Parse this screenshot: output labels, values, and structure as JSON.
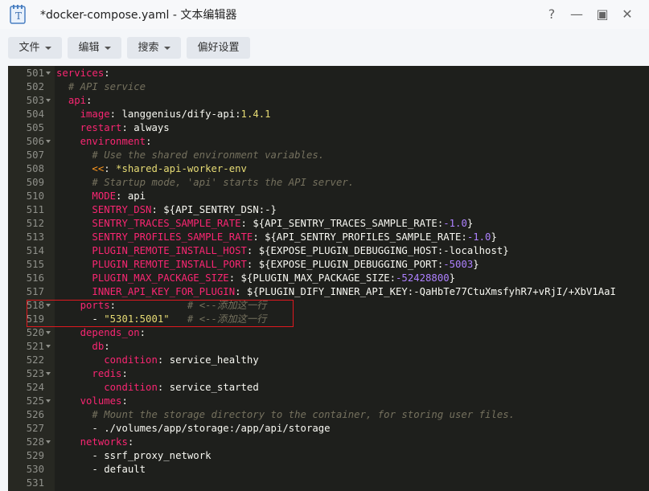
{
  "window": {
    "title": "*docker-compose.yaml - 文本编辑器",
    "controls": [
      "?",
      "—",
      "▣",
      "✕"
    ]
  },
  "toolbar": {
    "file": "文件",
    "edit": "编辑",
    "search": "搜索",
    "prefs": "偏好设置"
  },
  "lines": [
    {
      "no": "501",
      "fold": true,
      "parts": [
        [
          "k",
          "services"
        ],
        [
          "p",
          ":"
        ]
      ]
    },
    {
      "no": "502",
      "parts": [
        [
          "p",
          "  "
        ],
        [
          "c",
          "# API service"
        ]
      ]
    },
    {
      "no": "503",
      "fold": true,
      "parts": [
        [
          "p",
          "  "
        ],
        [
          "k",
          "api"
        ],
        [
          "p",
          ":"
        ]
      ]
    },
    {
      "no": "504",
      "parts": [
        [
          "p",
          "    "
        ],
        [
          "k",
          "image"
        ],
        [
          "p",
          ": "
        ],
        [
          "d",
          "langgenius/dify-api"
        ],
        [
          "p",
          ":"
        ],
        [
          "s",
          "1.4.1"
        ]
      ]
    },
    {
      "no": "505",
      "parts": [
        [
          "p",
          "    "
        ],
        [
          "k",
          "restart"
        ],
        [
          "p",
          ": "
        ],
        [
          "d",
          "always"
        ]
      ]
    },
    {
      "no": "506",
      "fold": true,
      "parts": [
        [
          "p",
          "    "
        ],
        [
          "k",
          "environment"
        ],
        [
          "p",
          ":"
        ]
      ]
    },
    {
      "no": "507",
      "parts": [
        [
          "p",
          "      "
        ],
        [
          "c",
          "# Use the shared environment variables."
        ]
      ]
    },
    {
      "no": "508",
      "parts": [
        [
          "p",
          "      "
        ],
        [
          "a",
          "<<"
        ],
        [
          "p",
          ": "
        ],
        [
          "s",
          "*shared-api-worker-env"
        ]
      ]
    },
    {
      "no": "509",
      "parts": [
        [
          "p",
          "      "
        ],
        [
          "c",
          "# Startup mode, 'api' starts the API server."
        ]
      ]
    },
    {
      "no": "510",
      "parts": [
        [
          "p",
          "      "
        ],
        [
          "k",
          "MODE"
        ],
        [
          "p",
          ": "
        ],
        [
          "d",
          "api"
        ]
      ]
    },
    {
      "no": "511",
      "parts": [
        [
          "p",
          "      "
        ],
        [
          "k",
          "SENTRY_DSN"
        ],
        [
          "p",
          ": "
        ],
        [
          "d",
          "${API_SENTRY_DSN:-}"
        ]
      ]
    },
    {
      "no": "512",
      "parts": [
        [
          "p",
          "      "
        ],
        [
          "k",
          "SENTRY_TRACES_SAMPLE_RATE"
        ],
        [
          "p",
          ": "
        ],
        [
          "d",
          "${API_SENTRY_TRACES_SAMPLE_RATE:"
        ],
        [
          "n",
          "-1.0"
        ],
        [
          "d",
          "}"
        ]
      ]
    },
    {
      "no": "513",
      "parts": [
        [
          "p",
          "      "
        ],
        [
          "k",
          "SENTRY_PROFILES_SAMPLE_RATE"
        ],
        [
          "p",
          ": "
        ],
        [
          "d",
          "${API_SENTRY_PROFILES_SAMPLE_RATE:"
        ],
        [
          "n",
          "-1.0"
        ],
        [
          "d",
          "}"
        ]
      ]
    },
    {
      "no": "514",
      "parts": [
        [
          "p",
          "      "
        ],
        [
          "k",
          "PLUGIN_REMOTE_INSTALL_HOST"
        ],
        [
          "p",
          ": "
        ],
        [
          "d",
          "${EXPOSE_PLUGIN_DEBUGGING_HOST:-localhost}"
        ]
      ]
    },
    {
      "no": "515",
      "parts": [
        [
          "p",
          "      "
        ],
        [
          "k",
          "PLUGIN_REMOTE_INSTALL_PORT"
        ],
        [
          "p",
          ": "
        ],
        [
          "d",
          "${EXPOSE_PLUGIN_DEBUGGING_PORT:"
        ],
        [
          "n",
          "-5003"
        ],
        [
          "d",
          "}"
        ]
      ]
    },
    {
      "no": "516",
      "parts": [
        [
          "p",
          "      "
        ],
        [
          "k",
          "PLUGIN_MAX_PACKAGE_SIZE"
        ],
        [
          "p",
          ": "
        ],
        [
          "d",
          "${PLUGIN_MAX_PACKAGE_SIZE:"
        ],
        [
          "n",
          "-52428800"
        ],
        [
          "d",
          "}"
        ]
      ]
    },
    {
      "no": "517",
      "parts": [
        [
          "p",
          "      "
        ],
        [
          "k",
          "INNER_API_KEY_FOR_PLUGIN"
        ],
        [
          "p",
          ": "
        ],
        [
          "d",
          "${PLUGIN_DIFY_INNER_API_KEY:-QaHbTe77CtuXmsfyhR7+vRjI/+XbV1AaI"
        ]
      ]
    },
    {
      "no": "518",
      "fold": true,
      "parts": [
        [
          "p",
          "    "
        ],
        [
          "k",
          "ports"
        ],
        [
          "p",
          ":            "
        ],
        [
          "c",
          "# <--添加这一行"
        ]
      ]
    },
    {
      "no": "519",
      "parts": [
        [
          "p",
          "      - "
        ],
        [
          "s",
          "\"5301:5001\""
        ],
        [
          "p",
          "   "
        ],
        [
          "c",
          "# <--添加这一行"
        ]
      ]
    },
    {
      "no": "520",
      "fold": true,
      "parts": [
        [
          "p",
          "    "
        ],
        [
          "k",
          "depends_on"
        ],
        [
          "p",
          ":"
        ]
      ]
    },
    {
      "no": "521",
      "fold": true,
      "parts": [
        [
          "p",
          "      "
        ],
        [
          "k",
          "db"
        ],
        [
          "p",
          ":"
        ]
      ]
    },
    {
      "no": "522",
      "parts": [
        [
          "p",
          "        "
        ],
        [
          "k",
          "condition"
        ],
        [
          "p",
          ": "
        ],
        [
          "d",
          "service_healthy"
        ]
      ]
    },
    {
      "no": "523",
      "fold": true,
      "parts": [
        [
          "p",
          "      "
        ],
        [
          "k",
          "redis"
        ],
        [
          "p",
          ":"
        ]
      ]
    },
    {
      "no": "524",
      "parts": [
        [
          "p",
          "        "
        ],
        [
          "k",
          "condition"
        ],
        [
          "p",
          ": "
        ],
        [
          "d",
          "service_started"
        ]
      ]
    },
    {
      "no": "525",
      "fold": true,
      "parts": [
        [
          "p",
          "    "
        ],
        [
          "k",
          "volumes"
        ],
        [
          "p",
          ":"
        ]
      ]
    },
    {
      "no": "526",
      "parts": [
        [
          "p",
          "      "
        ],
        [
          "c",
          "# Mount the storage directory to the container, for storing user files."
        ]
      ]
    },
    {
      "no": "527",
      "parts": [
        [
          "p",
          "      - "
        ],
        [
          "d",
          "./volumes/app/storage:/app/api/storage"
        ]
      ]
    },
    {
      "no": "528",
      "fold": true,
      "parts": [
        [
          "p",
          "    "
        ],
        [
          "k",
          "networks"
        ],
        [
          "p",
          ":"
        ]
      ]
    },
    {
      "no": "529",
      "parts": [
        [
          "p",
          "      - "
        ],
        [
          "d",
          "ssrf_proxy_network"
        ]
      ]
    },
    {
      "no": "530",
      "parts": [
        [
          "p",
          "      - "
        ],
        [
          "d",
          "default"
        ]
      ]
    },
    {
      "no": "531",
      "parts": []
    }
  ]
}
